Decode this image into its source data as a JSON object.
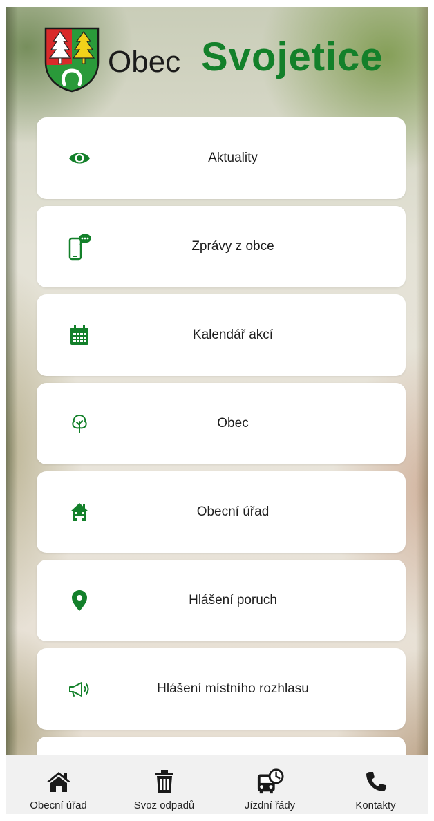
{
  "header": {
    "title_prefix": "Obec",
    "title_name": "Svojetice"
  },
  "colors": {
    "brand_green": "#13802a",
    "card_bg": "#ffffff",
    "nav_bg": "#f1f1f1"
  },
  "menu": {
    "items": [
      {
        "label": "Aktuality",
        "icon": "eye-icon"
      },
      {
        "label": "Zprávy z obce",
        "icon": "phone-message-icon"
      },
      {
        "label": "Kalendář akcí",
        "icon": "calendar-icon"
      },
      {
        "label": "Obec",
        "icon": "tree-icon"
      },
      {
        "label": "Obecní úřad",
        "icon": "town-hall-icon"
      },
      {
        "label": "Hlášení poruch",
        "icon": "map-pin-icon"
      },
      {
        "label": "Hlášení místního rozhlasu",
        "icon": "megaphone-icon"
      }
    ]
  },
  "bottom_nav": {
    "items": [
      {
        "label": "Obecní úřad",
        "icon": "home-icon"
      },
      {
        "label": "Svoz odpadů",
        "icon": "trash-icon"
      },
      {
        "label": "Jízdní řády",
        "icon": "bus-clock-icon"
      },
      {
        "label": "Kontakty",
        "icon": "phone-icon"
      }
    ]
  }
}
